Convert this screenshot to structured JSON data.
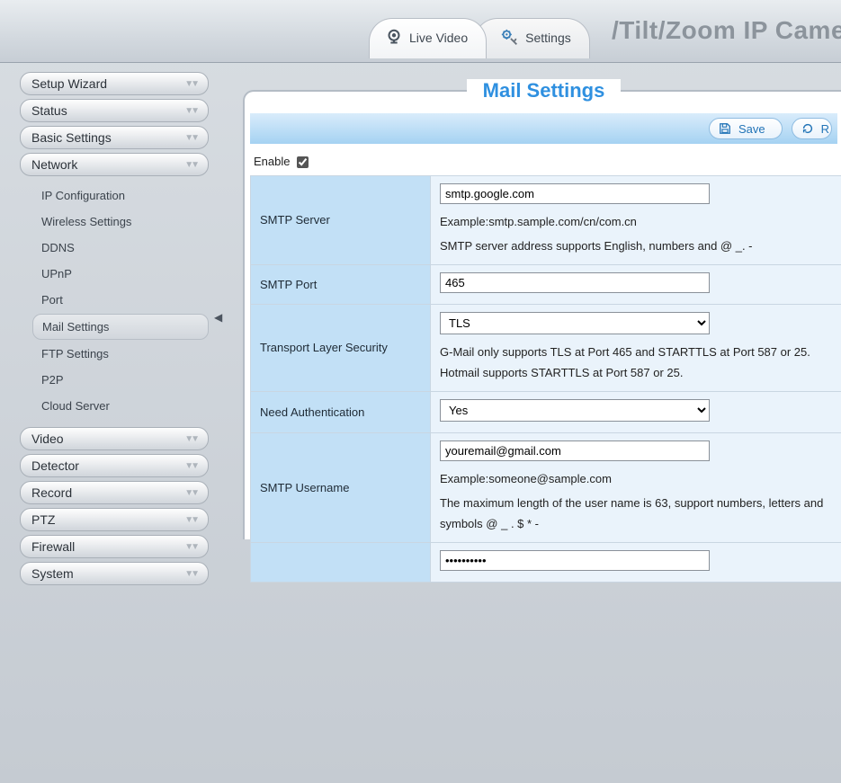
{
  "header": {
    "tabs": {
      "live": "Live Video",
      "settings": "Settings"
    },
    "title_fragment": "/Tilt/Zoom IP Came"
  },
  "sidebar": {
    "sections": [
      {
        "label": "Setup Wizard"
      },
      {
        "label": "Status"
      },
      {
        "label": "Basic Settings"
      },
      {
        "label": "Network",
        "expanded": true
      },
      {
        "label": "Video"
      },
      {
        "label": "Detector"
      },
      {
        "label": "Record"
      },
      {
        "label": "PTZ"
      },
      {
        "label": "Firewall"
      },
      {
        "label": "System"
      }
    ],
    "network_items": [
      {
        "label": "IP Configuration"
      },
      {
        "label": "Wireless Settings"
      },
      {
        "label": "DDNS"
      },
      {
        "label": "UPnP"
      },
      {
        "label": "Port"
      },
      {
        "label": "Mail Settings",
        "active": true
      },
      {
        "label": "FTP Settings"
      },
      {
        "label": "P2P"
      },
      {
        "label": "Cloud Server"
      }
    ]
  },
  "panel": {
    "title": "Mail Settings",
    "actions": {
      "save": "Save",
      "refresh": "R"
    },
    "enable_label": "Enable",
    "enable_checked": true,
    "rows": {
      "smtp_server": {
        "label": "SMTP Server",
        "value": "smtp.google.com",
        "hint1": "Example:smtp.sample.com/cn/com.cn",
        "hint2": "SMTP server address supports English, numbers and @ _. -"
      },
      "smtp_port": {
        "label": "SMTP Port",
        "value": "465"
      },
      "tls": {
        "label": "Transport Layer Security",
        "value": "TLS",
        "hint": "G-Mail only supports TLS at Port 465 and STARTTLS at Port 587 or 25. Hotmail supports STARTTLS at Port 587 or 25."
      },
      "auth": {
        "label": "Need Authentication",
        "value": "Yes"
      },
      "username": {
        "label": "SMTP Username",
        "value": "youremail@gmail.com",
        "hint1": "Example:someone@sample.com",
        "hint2": "The maximum length of the user name is 63, support numbers, letters and symbols @ _ . $ * -"
      },
      "password": {
        "value": "••••••••••"
      }
    }
  }
}
